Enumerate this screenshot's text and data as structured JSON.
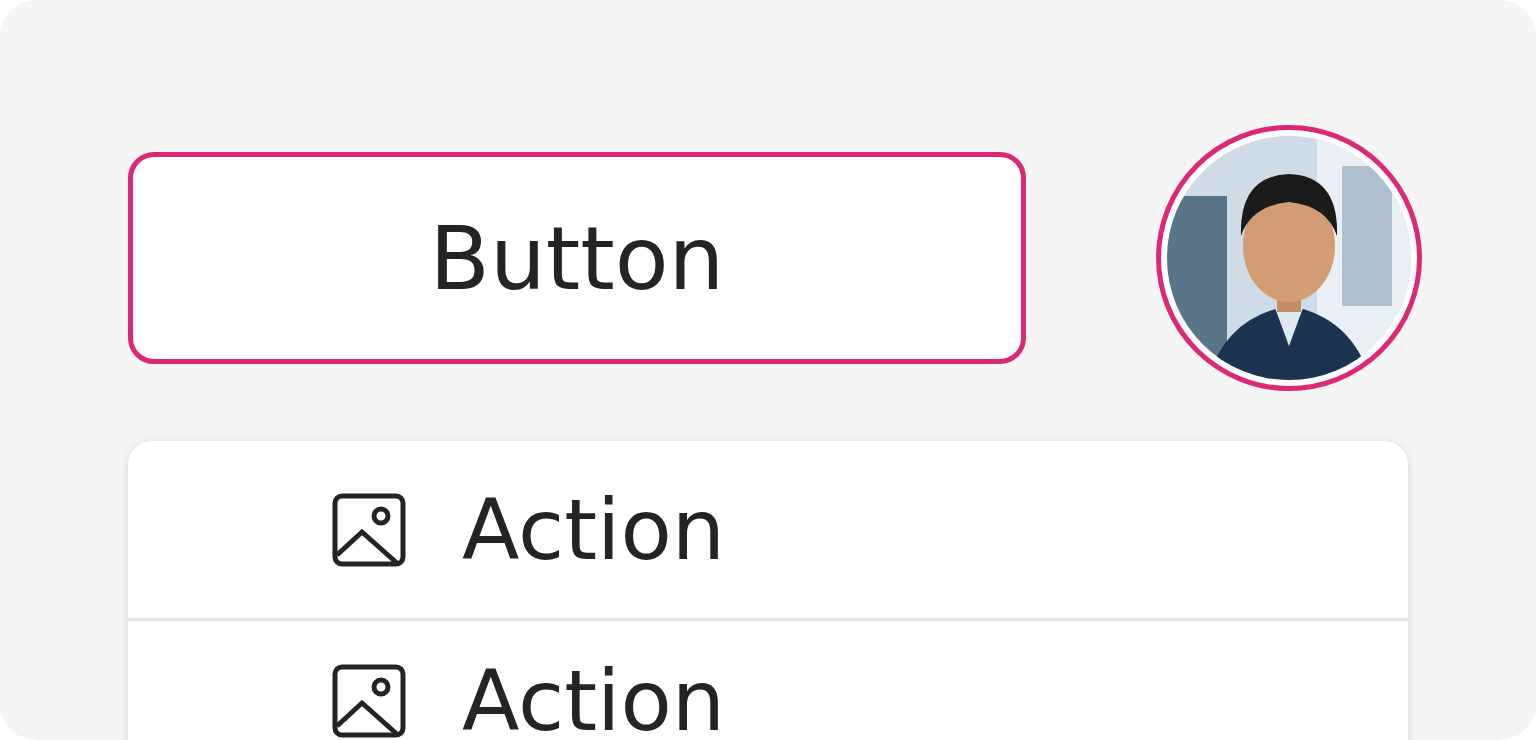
{
  "button": {
    "label": "Button"
  },
  "menu": {
    "items": [
      {
        "label": "Action"
      },
      {
        "label": "Action"
      }
    ]
  }
}
